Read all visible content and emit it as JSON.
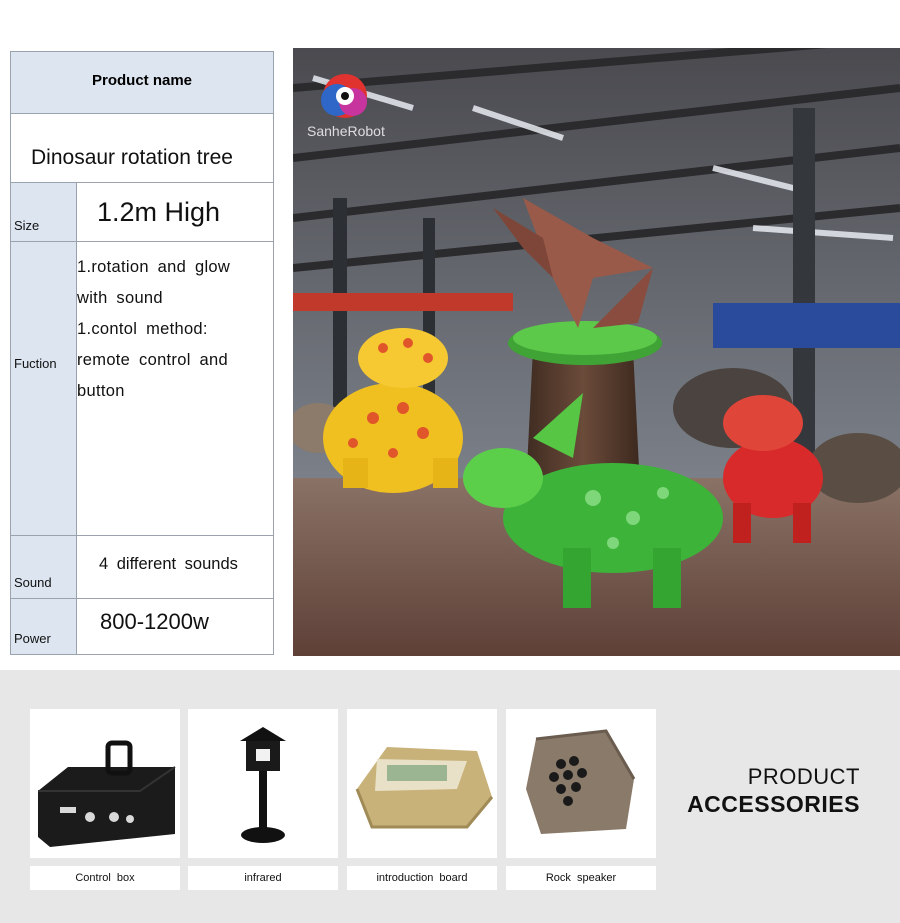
{
  "spec_table": {
    "header": "Product  name",
    "product_name": "Dinosaur rotation tree",
    "rows": [
      {
        "label": "Size",
        "value": "1.2m   High"
      },
      {
        "label": "Fuction",
        "lines": [
          "1.rotation  and  glow",
          "with  sound",
          "1.contol  method:",
          "remote  control  and",
          "button"
        ]
      },
      {
        "label": "Sound",
        "value": "4  different  sounds"
      },
      {
        "label": "Power",
        "value": "800-1200w"
      }
    ]
  },
  "photo": {
    "watermark": "SanheRobot"
  },
  "accessories": {
    "title_line1": "PRODUCT",
    "title_line2": "ACCESSORIES",
    "items": [
      {
        "label": "Control  box",
        "icon": "control-box-icon"
      },
      {
        "label": "infrared",
        "icon": "infrared-sensor-icon"
      },
      {
        "label": "introduction  board",
        "icon": "introduction-board-icon"
      },
      {
        "label": "Rock  speaker",
        "icon": "rock-speaker-icon"
      }
    ]
  },
  "colors": {
    "label_bg": "#dde5f0",
    "border": "#9aa3ad",
    "page_bg": "#e7e7e7"
  }
}
